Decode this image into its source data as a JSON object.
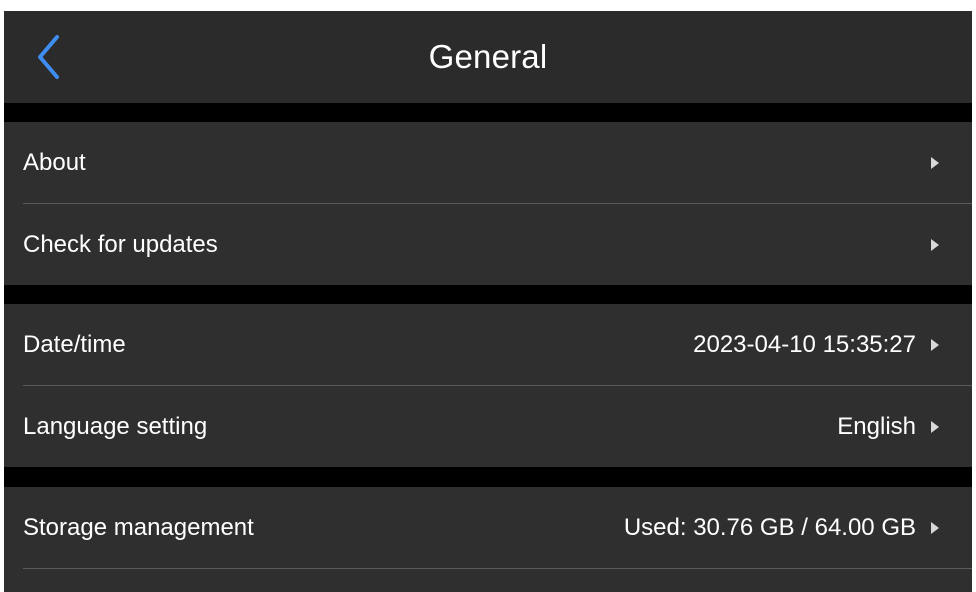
{
  "header": {
    "title": "General",
    "back_icon": "chevron-left-icon",
    "back_icon_color": "#3d8ef0"
  },
  "groups": [
    {
      "rows": [
        {
          "label": "About",
          "value": ""
        },
        {
          "label": "Check for updates",
          "value": ""
        }
      ]
    },
    {
      "rows": [
        {
          "label": "Date/time",
          "value": "2023-04-10 15:35:27"
        },
        {
          "label": "Language setting",
          "value": "English"
        }
      ]
    },
    {
      "rows": [
        {
          "label": "Storage management",
          "value": "Used: 30.76 GB / 64.00 GB"
        }
      ]
    }
  ],
  "colors": {
    "background": "#000000",
    "header": "#2b2b2b",
    "row": "#2f2f2f",
    "text": "#ffffff",
    "accent": "#3d8ef0"
  }
}
